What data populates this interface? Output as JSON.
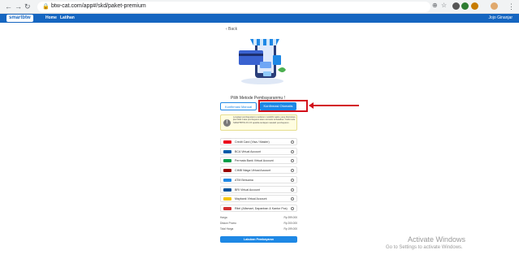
{
  "browser": {
    "url": "btw-cat.com/app#/skd/paket-premium",
    "back_glyph": "←",
    "forward_glyph": "→",
    "reload_glyph": "↻",
    "lock_glyph": "🔒",
    "menu_glyph": "⋮"
  },
  "app": {
    "logo": "smartbtw",
    "nav": [
      "Home",
      "Latihan"
    ],
    "user": "Jojo Ginanjar"
  },
  "page": {
    "back_label": "‹ Back",
    "title": "Pilih Metode Pembayaranmu !",
    "tabs": {
      "manual": "Konfirmasi Manual",
      "auto": "Konfirmasi Otomatis"
    },
    "info_text": "Lengkapi pembayaranmu sebelum melebihi waktu yang ditentukan, jika tidak maka pembayaran akan otomatis terbatalkan. Ketik kode SMARTBTW-XX-XX apabila terdapat masalah pembayaran.",
    "info_icon": "!",
    "methods": [
      {
        "label": "Credit Card (Visa / Master)",
        "color": "#eb001b"
      },
      {
        "label": "BCA Virtual Account",
        "color": "#005aa9"
      },
      {
        "label": "Permata Bank Virtual Account",
        "color": "#009e49"
      },
      {
        "label": "CIMB Niaga Virtual Account",
        "color": "#990000"
      },
      {
        "label": "ATM Bersama",
        "color": "#1e88e5"
      },
      {
        "label": "BRI Virtual Account",
        "color": "#00529c"
      },
      {
        "label": "Maybank Virtual Account",
        "color": "#f5c400"
      },
      {
        "label": "Ritel (Alfamart, Dapanban & Kantor Pos)",
        "color": "#d32f2f"
      }
    ],
    "totals": [
      {
        "label": "Harga",
        "value": "Rp 399.000"
      },
      {
        "label": "Diskon Promo",
        "value": "Rp 200.000"
      },
      {
        "label": "Total Harga",
        "value": "Rp 199.000"
      }
    ],
    "pay_button": "Lakukan Pembayaran"
  },
  "watermark": {
    "line1": "Activate Windows",
    "line2": "Go to Settings to activate Windows."
  },
  "colors": {
    "brand": "#1565c0",
    "accent": "#1e88e5",
    "highlight": "#d3101a"
  }
}
